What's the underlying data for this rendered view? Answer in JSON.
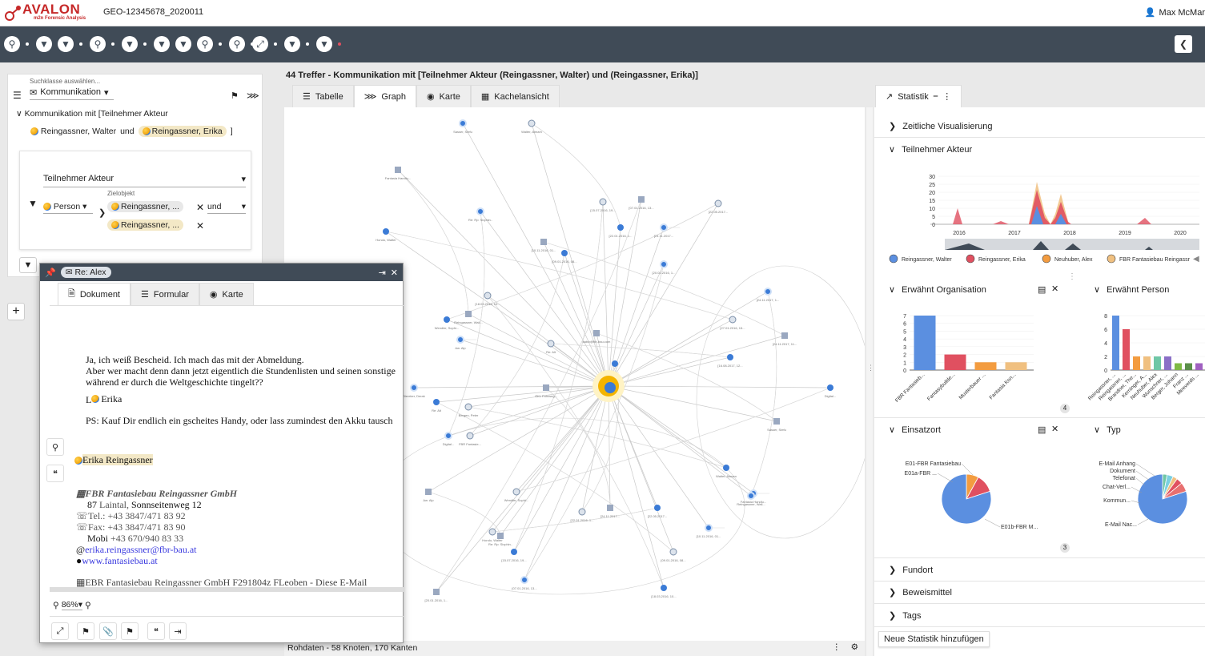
{
  "app": {
    "logo_title": "AVALON",
    "logo_sub": "m2n Forensic Analysis",
    "case_id": "GEO-12345678_2020011",
    "user": "Max McMar"
  },
  "left": {
    "search_class_label": "Suchklasse auswählen...",
    "search_class": "Kommunikation",
    "query_prefix": "Kommunikation mit [",
    "query_prefix2": "Teilnehmer Akteur",
    "query_p1": "Reingassner, Walter",
    "query_and": "und",
    "query_p2": "Reingassner, Erika",
    "query_close": "]",
    "filter": {
      "field": "Teilnehmer Akteur",
      "type": "Person",
      "target_label": "Zielobjekt",
      "t1": "Reingassner, ...",
      "t2": "Reingassner, ...",
      "op": "und"
    }
  },
  "graph": {
    "heading": "44 Treffer - Kommunikation mit [Teilnehmer Akteur (Reingassner, Walter) und (Reingassner, Erika)]",
    "tabs": [
      "Tabelle",
      "Graph",
      "Karte",
      "Kachelansicht"
    ],
    "status": "Rohdaten - 58 Knoten, 170 Kanten",
    "node_labels": [
      "Sasser, Stefu",
      "Walter, Almam",
      "Fantasia Handlu...",
      "Hondo, Walter",
      "Re: Rp: Sixphin..",
      "[15.07.2016, 19...",
      "[07.01.2016, 13...",
      "[22.01.2016, 1...",
      "[24.11.2017...",
      "[22.05.2017...",
      "[10.11.2016, 01...",
      "[09.01.2016, 08...",
      "[20.01.2016, 1...",
      "[18.03.2016, 10...",
      "Reingassner, Wall...",
      "Wendler, Sophi...",
      "Aw: Alp",
      "Re: Alt",
      "sabiv@fbr-bau.com",
      "Re: ...",
      "[24.11.2017, 1...",
      "[27.01.2016, 15...",
      "[24.11.2017, 11...",
      "[16.08.2017, 12...",
      "Biereker, Derak",
      "Bergen, Peter",
      "ÖKL Fahrweg...",
      "Digital...",
      "Digital...",
      "FBR Fantasie..."
    ]
  },
  "stats": {
    "tab": "Statistik",
    "sections": {
      "zeitlich": "Zeitliche Visualisierung",
      "teilnehmer": "Teilnehmer Akteur",
      "org": "Erwähnt Organisation",
      "person": "Erwähnt Person",
      "einsatz": "Einsatzort",
      "typ": "Typ",
      "fundort": "Fundort",
      "beweis": "Beweismittel",
      "tags": "Tags"
    },
    "add_button": "Neue Statistik hinzufügen",
    "page_badges": {
      "b1": "4",
      "b2": "3"
    },
    "timeline": {
      "y_ticks": [
        "30",
        "25",
        "20",
        "15",
        "10",
        "5",
        "0"
      ],
      "x_ticks": [
        "2016",
        "2017",
        "2018",
        "2019",
        "2020"
      ],
      "legend": [
        {
          "name": "Reingassner, Walter",
          "color": "#5b8fe0"
        },
        {
          "name": "Reingassner, Erika",
          "color": "#e05060"
        },
        {
          "name": "Neuhuber, Alex",
          "color": "#f39c40"
        },
        {
          "name": "FBR Fantasiebau Reingassr",
          "color": "#f0c080"
        }
      ]
    }
  },
  "chart_data": [
    {
      "type": "bar",
      "title": "Erwähnt Organisation",
      "categories": [
        "FBR Fantasieb...",
        "Fantasybuilde...",
        "Musterbauer ...",
        "Fantasia Kon..."
      ],
      "values": [
        7,
        2,
        1,
        1
      ],
      "ylim": [
        0,
        7
      ],
      "y_ticks": [
        "7",
        "6",
        "5",
        "4",
        "3",
        "2",
        "1",
        "0"
      ],
      "colors": [
        "#5b8fe0",
        "#e05060",
        "#f39c40",
        "#f0c080"
      ]
    },
    {
      "type": "bar",
      "title": "Erwähnt Person",
      "categories": [
        "Reingassner, ...",
        "Reingassner, ...",
        "Brandner, The...",
        "Kerninger, A...",
        "Neuhuber, Alex",
        "Wunschner, ...",
        "Berger, Johann",
        "Franz ...",
        "Meeverds ..."
      ],
      "values": [
        8,
        6,
        2,
        2,
        2,
        2,
        1,
        1,
        1
      ],
      "ylim": [
        0,
        8
      ],
      "y_ticks": [
        "8",
        "6",
        "4",
        "2",
        "0"
      ],
      "colors": [
        "#5b8fe0",
        "#e05060",
        "#f39c40",
        "#f0c080",
        "#6fc7a6",
        "#8a6fc7",
        "#7fba44",
        "#5b8f4a",
        "#a060c0"
      ]
    },
    {
      "type": "pie",
      "title": "Einsatzort",
      "labels": [
        "E01-FBR Fantasiebau",
        "E01a-FBR ...",
        "E01b-FBR M..."
      ],
      "values": [
        8,
        12,
        80
      ],
      "colors": [
        "#f39c40",
        "#e05060",
        "#5b8fe0"
      ]
    },
    {
      "type": "pie",
      "title": "Typ",
      "labels": [
        "E-Mail Anhang",
        "Dokument",
        "Telefonat",
        "Chat-Verl...",
        "Kommun...",
        "E-Mail Nac..."
      ],
      "values": [
        3,
        4,
        3,
        4,
        6,
        80
      ],
      "colors": [
        "#6fc7a6",
        "#7ad0e0",
        "#f0c080",
        "#e05060",
        "#e87070",
        "#5b8fe0"
      ]
    }
  ],
  "doc": {
    "title": "Re: Alex",
    "tabs": [
      "Dokument",
      "Formular",
      "Karte"
    ],
    "zoom": "86%",
    "l1": "Ja, ich weiß Bescheid. Ich mach das mit der Abmeldung.",
    "l2": "Aber wer macht denn dann jetzt eigentlich die Stundenlisten und seinen sonstige",
    "l3": "während er durch die Weltgeschichte tingelt??",
    "greet_prefix": "L",
    "greet_name": "Erika",
    "ps": "PS: Kauf Dir endlich ein gscheites Handy, oder lass zumindest den Akku tausch",
    "sender": "Erika Reingassner",
    "company": "FBR Fantasiebau Reingassner GmbH",
    "addr_a": "87",
    "addr_b": "Laintal,",
    "addr_c": "Sonnseitenweg 12",
    "tel": "Tel.: +43 3847/471 83 92",
    "fax": "Fax: +43 3847/471 83 90",
    "mobil_a": "Mobi",
    "mobil_b": "+43 670/940 83 33",
    "email": "erika.reingassner@fbr-bau.at",
    "web": "www.fantasiebau.at",
    "footer_a": "EBR Fantasiebau Reingassner GmbH",
    "footer_b": "F",
    "footer_c": "291804z",
    "footer_d": "F",
    "footer_e": "Leoben - Diese E-Mail"
  }
}
